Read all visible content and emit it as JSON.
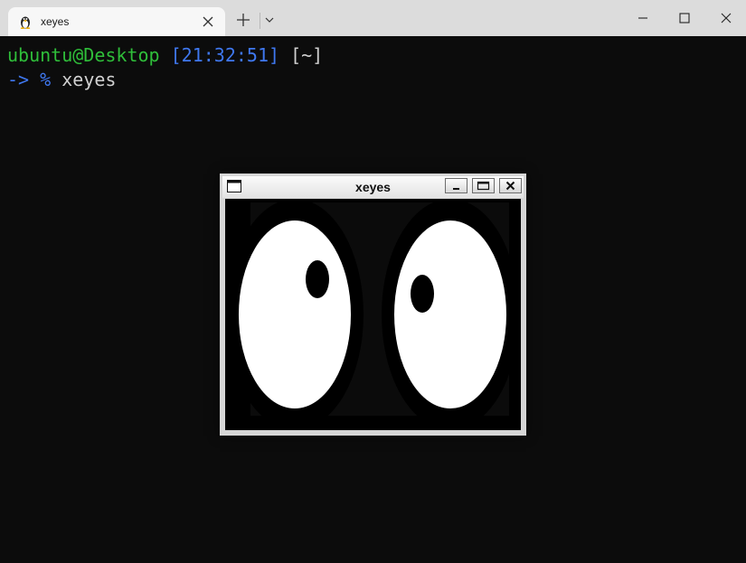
{
  "tab": {
    "title": "xeyes",
    "icon": "linux-penguin-icon"
  },
  "terminal": {
    "prompt_user_host": "ubuntu@Desktop",
    "prompt_time": "[21:32:51]",
    "prompt_dir": "[~]",
    "prompt_arrow": "->",
    "prompt_symbol": "%",
    "command": "xeyes"
  },
  "xeyes_window": {
    "title": "xeyes"
  },
  "colors": {
    "prompt_green": "#2fbe3a",
    "prompt_blue": "#3f78f0",
    "terminal_bg": "#0c0c0c"
  }
}
